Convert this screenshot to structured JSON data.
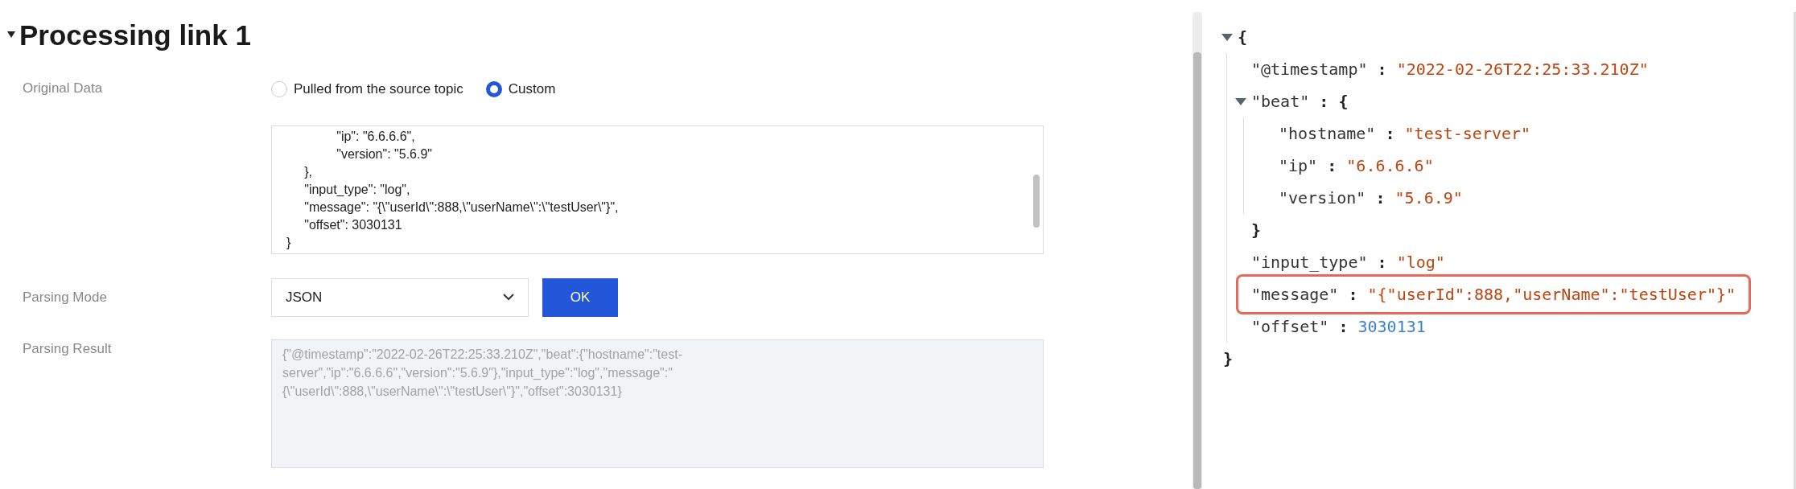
{
  "section": {
    "title": "Processing link 1",
    "expanded": true
  },
  "original_data": {
    "label": "Original Data",
    "options": [
      {
        "label": "Pulled from the source topic",
        "selected": false
      },
      {
        "label": "Custom",
        "selected": true
      }
    ],
    "editor_value": "              \"ip\": \"6.6.6.6\",\n              \"version\": \"5.6.9\"\n     },\n     \"input_type\": \"log\",\n     \"message\": \"{\\\"userId\\\":888,\\\"userName\\\":\\\"testUser\\\"}\",\n     \"offset\": 3030131\n}"
  },
  "parsing_mode": {
    "label": "Parsing Mode",
    "value": "JSON",
    "button": "OK"
  },
  "parsing_result": {
    "label": "Parsing Result",
    "value": "{\"@timestamp\":\"2022-02-26T22:25:33.210Z\",\"beat\":{\"hostname\":\"test-server\",\"ip\":\"6.6.6.6\",\"version\":\"5.6.9\"},\"input_type\":\"log\",\"message\":\"{\\\"userId\\\":888,\\\"userName\\\":\\\"testUser\\\"}\",\"offset\":3030131}",
    "disabled": true
  },
  "viewer": {
    "open": "{",
    "close": "}",
    "expanded": true,
    "entries": [
      {
        "kind": "string",
        "key": "\"@timestamp\"",
        "colon": ":",
        "value": "\"2022-02-26T22:25:33.210Z\"",
        "highlighted": false
      },
      {
        "kind": "object",
        "key": "\"beat\"",
        "colon": ":",
        "open": "{",
        "close": "}",
        "expanded": true,
        "children": [
          {
            "kind": "string",
            "key": "\"hostname\"",
            "colon": ":",
            "value": "\"test-server\"",
            "highlighted": false
          },
          {
            "kind": "string",
            "key": "\"ip\"",
            "colon": ":",
            "value": "\"6.6.6.6\"",
            "highlighted": false
          },
          {
            "kind": "string",
            "key": "\"version\"",
            "colon": ":",
            "value": "\"5.6.9\"",
            "highlighted": false
          }
        ]
      },
      {
        "kind": "string",
        "key": "\"input_type\"",
        "colon": ":",
        "value": "\"log\"",
        "highlighted": false
      },
      {
        "kind": "string",
        "key": "\"message\"",
        "colon": ":",
        "value": "\"{\"userId\":888,\"userName\":\"testUser\"}\"",
        "highlighted": true
      },
      {
        "kind": "number",
        "key": "\"offset\"",
        "colon": ":",
        "value": "3030131",
        "highlighted": false
      }
    ]
  }
}
